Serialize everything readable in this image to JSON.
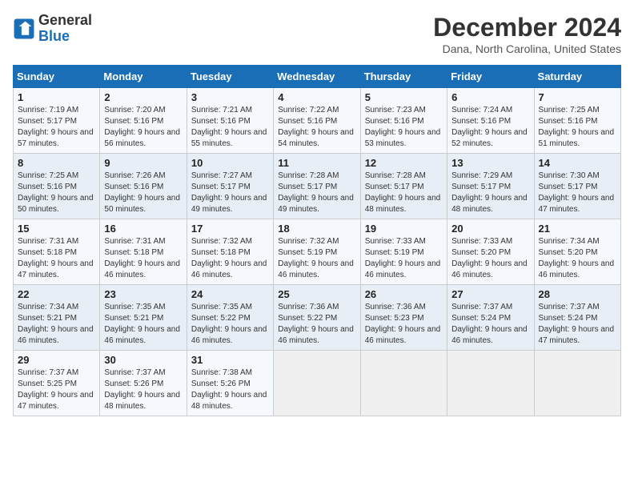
{
  "header": {
    "logo_line1": "General",
    "logo_line2": "Blue",
    "month": "December 2024",
    "location": "Dana, North Carolina, United States"
  },
  "weekdays": [
    "Sunday",
    "Monday",
    "Tuesday",
    "Wednesday",
    "Thursday",
    "Friday",
    "Saturday"
  ],
  "weeks": [
    [
      {
        "day": "1",
        "info": "Sunrise: 7:19 AM\nSunset: 5:17 PM\nDaylight: 9 hours and 57 minutes."
      },
      {
        "day": "2",
        "info": "Sunrise: 7:20 AM\nSunset: 5:16 PM\nDaylight: 9 hours and 56 minutes."
      },
      {
        "day": "3",
        "info": "Sunrise: 7:21 AM\nSunset: 5:16 PM\nDaylight: 9 hours and 55 minutes."
      },
      {
        "day": "4",
        "info": "Sunrise: 7:22 AM\nSunset: 5:16 PM\nDaylight: 9 hours and 54 minutes."
      },
      {
        "day": "5",
        "info": "Sunrise: 7:23 AM\nSunset: 5:16 PM\nDaylight: 9 hours and 53 minutes."
      },
      {
        "day": "6",
        "info": "Sunrise: 7:24 AM\nSunset: 5:16 PM\nDaylight: 9 hours and 52 minutes."
      },
      {
        "day": "7",
        "info": "Sunrise: 7:25 AM\nSunset: 5:16 PM\nDaylight: 9 hours and 51 minutes."
      }
    ],
    [
      {
        "day": "8",
        "info": "Sunrise: 7:25 AM\nSunset: 5:16 PM\nDaylight: 9 hours and 50 minutes."
      },
      {
        "day": "9",
        "info": "Sunrise: 7:26 AM\nSunset: 5:16 PM\nDaylight: 9 hours and 50 minutes."
      },
      {
        "day": "10",
        "info": "Sunrise: 7:27 AM\nSunset: 5:17 PM\nDaylight: 9 hours and 49 minutes."
      },
      {
        "day": "11",
        "info": "Sunrise: 7:28 AM\nSunset: 5:17 PM\nDaylight: 9 hours and 49 minutes."
      },
      {
        "day": "12",
        "info": "Sunrise: 7:28 AM\nSunset: 5:17 PM\nDaylight: 9 hours and 48 minutes."
      },
      {
        "day": "13",
        "info": "Sunrise: 7:29 AM\nSunset: 5:17 PM\nDaylight: 9 hours and 48 minutes."
      },
      {
        "day": "14",
        "info": "Sunrise: 7:30 AM\nSunset: 5:17 PM\nDaylight: 9 hours and 47 minutes."
      }
    ],
    [
      {
        "day": "15",
        "info": "Sunrise: 7:31 AM\nSunset: 5:18 PM\nDaylight: 9 hours and 47 minutes."
      },
      {
        "day": "16",
        "info": "Sunrise: 7:31 AM\nSunset: 5:18 PM\nDaylight: 9 hours and 46 minutes."
      },
      {
        "day": "17",
        "info": "Sunrise: 7:32 AM\nSunset: 5:18 PM\nDaylight: 9 hours and 46 minutes."
      },
      {
        "day": "18",
        "info": "Sunrise: 7:32 AM\nSunset: 5:19 PM\nDaylight: 9 hours and 46 minutes."
      },
      {
        "day": "19",
        "info": "Sunrise: 7:33 AM\nSunset: 5:19 PM\nDaylight: 9 hours and 46 minutes."
      },
      {
        "day": "20",
        "info": "Sunrise: 7:33 AM\nSunset: 5:20 PM\nDaylight: 9 hours and 46 minutes."
      },
      {
        "day": "21",
        "info": "Sunrise: 7:34 AM\nSunset: 5:20 PM\nDaylight: 9 hours and 46 minutes."
      }
    ],
    [
      {
        "day": "22",
        "info": "Sunrise: 7:34 AM\nSunset: 5:21 PM\nDaylight: 9 hours and 46 minutes."
      },
      {
        "day": "23",
        "info": "Sunrise: 7:35 AM\nSunset: 5:21 PM\nDaylight: 9 hours and 46 minutes."
      },
      {
        "day": "24",
        "info": "Sunrise: 7:35 AM\nSunset: 5:22 PM\nDaylight: 9 hours and 46 minutes."
      },
      {
        "day": "25",
        "info": "Sunrise: 7:36 AM\nSunset: 5:22 PM\nDaylight: 9 hours and 46 minutes."
      },
      {
        "day": "26",
        "info": "Sunrise: 7:36 AM\nSunset: 5:23 PM\nDaylight: 9 hours and 46 minutes."
      },
      {
        "day": "27",
        "info": "Sunrise: 7:37 AM\nSunset: 5:24 PM\nDaylight: 9 hours and 46 minutes."
      },
      {
        "day": "28",
        "info": "Sunrise: 7:37 AM\nSunset: 5:24 PM\nDaylight: 9 hours and 47 minutes."
      }
    ],
    [
      {
        "day": "29",
        "info": "Sunrise: 7:37 AM\nSunset: 5:25 PM\nDaylight: 9 hours and 47 minutes."
      },
      {
        "day": "30",
        "info": "Sunrise: 7:37 AM\nSunset: 5:26 PM\nDaylight: 9 hours and 48 minutes."
      },
      {
        "day": "31",
        "info": "Sunrise: 7:38 AM\nSunset: 5:26 PM\nDaylight: 9 hours and 48 minutes."
      },
      null,
      null,
      null,
      null
    ]
  ]
}
